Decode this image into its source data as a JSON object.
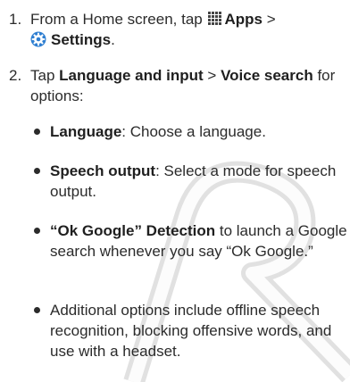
{
  "step1": {
    "number": "1.",
    "pre": "From a Home screen, tap",
    "apps_label": "Apps",
    "sep": ">",
    "settings_label": "Settings",
    "end": ".",
    "apps_icon": "apps-grid-icon",
    "settings_icon": "gear-icon"
  },
  "step2": {
    "number": "2.",
    "pre": "Tap",
    "bold1": "Language and input",
    "sep": ">",
    "bold2": "Voice search",
    "post": "for options:"
  },
  "bullets": [
    {
      "bold": "Language",
      "text": ": Choose a language."
    },
    {
      "bold": "Speech output",
      "text": ": Select a mode for speech output."
    },
    {
      "bold": "“Ok Google” Detection",
      "text": " to launch a Google search whenever you say “Ok Google.”"
    },
    {
      "bold": "",
      "text": "Additional options include offline speech recognition, blocking offensive words, and use with a headset."
    }
  ]
}
